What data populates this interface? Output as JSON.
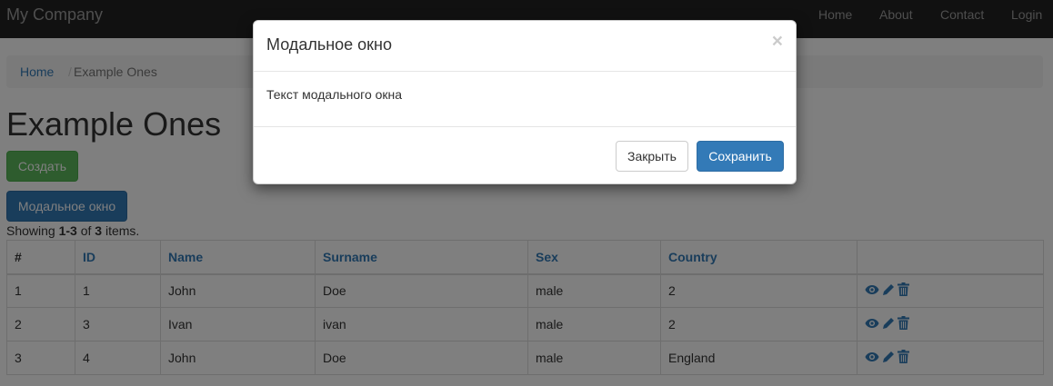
{
  "navbar": {
    "brand": "My Company",
    "links": [
      "Home",
      "About",
      "Contact",
      "Login"
    ]
  },
  "breadcrumb": {
    "home": "Home",
    "separator": "/",
    "current": "Example Ones"
  },
  "page": {
    "title": "Example Ones",
    "create_button": "Создать",
    "modal_button": "Модальное окно"
  },
  "summary": {
    "prefix": "Showing ",
    "range": "1-3",
    "middle": " of ",
    "total": "3",
    "suffix": " items."
  },
  "table": {
    "headers": [
      "#",
      "ID",
      "Name",
      "Surname",
      "Sex",
      "Country",
      ""
    ],
    "rows": [
      [
        "1",
        "1",
        "John",
        "Doe",
        "male",
        "2"
      ],
      [
        "2",
        "3",
        "Ivan",
        "ivan",
        "male",
        "2"
      ],
      [
        "3",
        "4",
        "John",
        "Doe",
        "male",
        "England"
      ]
    ],
    "row_actions": [
      "eye-icon",
      "pencil-icon",
      "trash-icon"
    ]
  },
  "modal": {
    "title": "Модальное окно",
    "close_glyph": "×",
    "body": "Текст модального окна",
    "close_button": "Закрыть",
    "save_button": "Сохранить"
  },
  "colors": {
    "navbar_bg": "#222222",
    "link": "#337ab7",
    "success": "#5cb85c",
    "primary": "#337ab7"
  }
}
